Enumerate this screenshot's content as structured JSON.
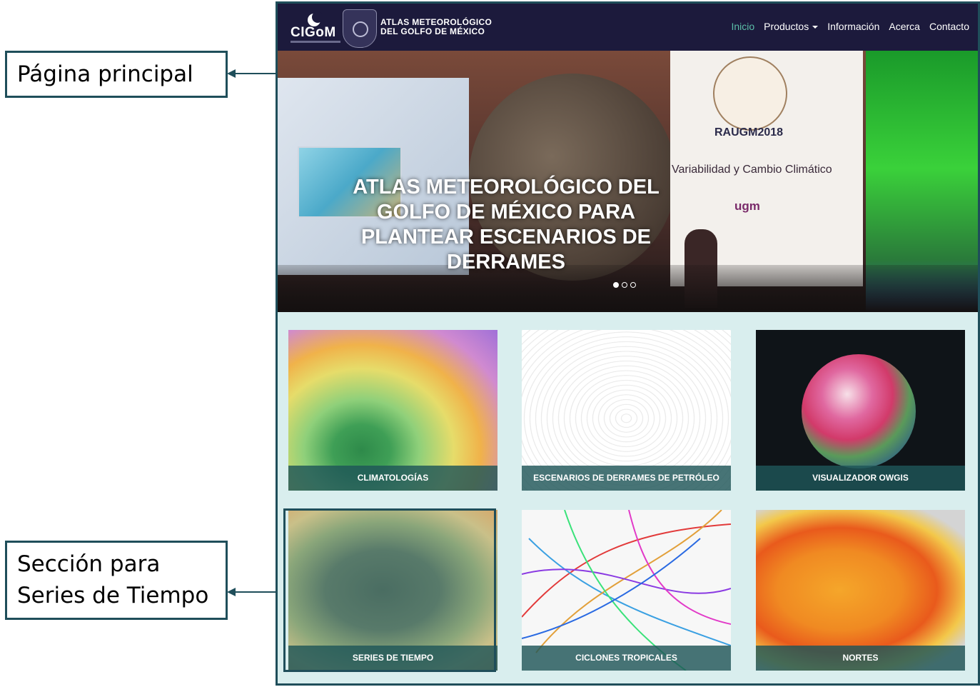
{
  "annotations": {
    "home_page": "Página principal",
    "time_series_section": [
      "Sección para",
      "Series de Tiempo"
    ]
  },
  "navbar": {
    "logo_text": "CIGoM",
    "site_title": [
      "ATLAS METEOROLÓGICO",
      "DEL GOLFO DE MÉXICO"
    ],
    "links": {
      "inicio": "Inicio",
      "productos": "Productos",
      "informacion": "Información",
      "acerca": "Acerca",
      "contacto": "Contacto"
    },
    "active_link": "Inicio"
  },
  "hero": {
    "title": "ATLAS METEOROLÓGICO DEL GOLFO DE MÉXICO PARA PLANTEAR ESCENARIOS DE DERRAMES",
    "photo_text": {
      "event": "RAUGM2018",
      "theme": "Variabilidad y Cambio Climático",
      "org": "ugm"
    },
    "slides": 3,
    "active_slide": 1
  },
  "products": {
    "climatologias": "CLIMATOLOGÍAS",
    "derrames": "ESCENARIOS DE DERRAMES DE PETRÓLEO",
    "owgis": "VISUALIZADOR OWGIS",
    "series": "SERIES DE TIEMPO",
    "ciclones": "CICLONES TROPICALES",
    "nortes": "NORTES"
  },
  "colors": {
    "navbar": "#1c1a3c",
    "active_link": "#5bbfa8",
    "page_background": "#d9eeee",
    "caption_background": "#1f5658",
    "annotation_border": "#1f4e5a"
  }
}
